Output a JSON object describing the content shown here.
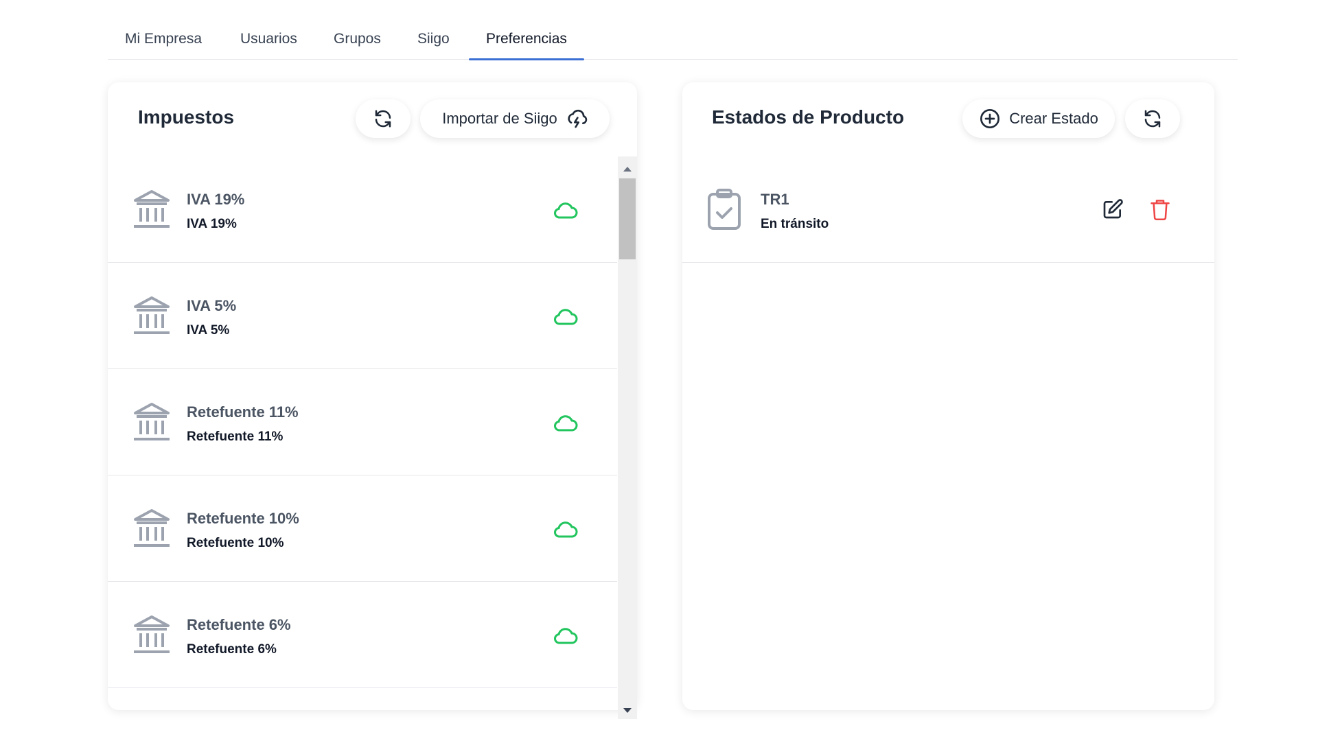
{
  "tabs": [
    {
      "label": "Mi Empresa"
    },
    {
      "label": "Usuarios"
    },
    {
      "label": "Grupos"
    },
    {
      "label": "Siigo"
    },
    {
      "label": "Preferencias",
      "active": true
    }
  ],
  "impuestos": {
    "title": "Impuestos",
    "import_label": "Importar de Siigo",
    "items": [
      {
        "name": "IVA 19%",
        "desc": "IVA 19%"
      },
      {
        "name": "IVA 5%",
        "desc": "IVA 5%"
      },
      {
        "name": "Retefuente 11%",
        "desc": "Retefuente 11%"
      },
      {
        "name": "Retefuente 10%",
        "desc": "Retefuente 10%"
      },
      {
        "name": "Retefuente 6%",
        "desc": "Retefuente 6%"
      }
    ]
  },
  "estados": {
    "title": "Estados de Producto",
    "create_label": "Crear Estado",
    "items": [
      {
        "name": "TR1",
        "desc": "En tránsito"
      }
    ]
  },
  "colors": {
    "accent": "#3b6fd4",
    "cloud": "#22c55e",
    "delete": "#ef4444",
    "icon_gray": "#9ca3af"
  }
}
